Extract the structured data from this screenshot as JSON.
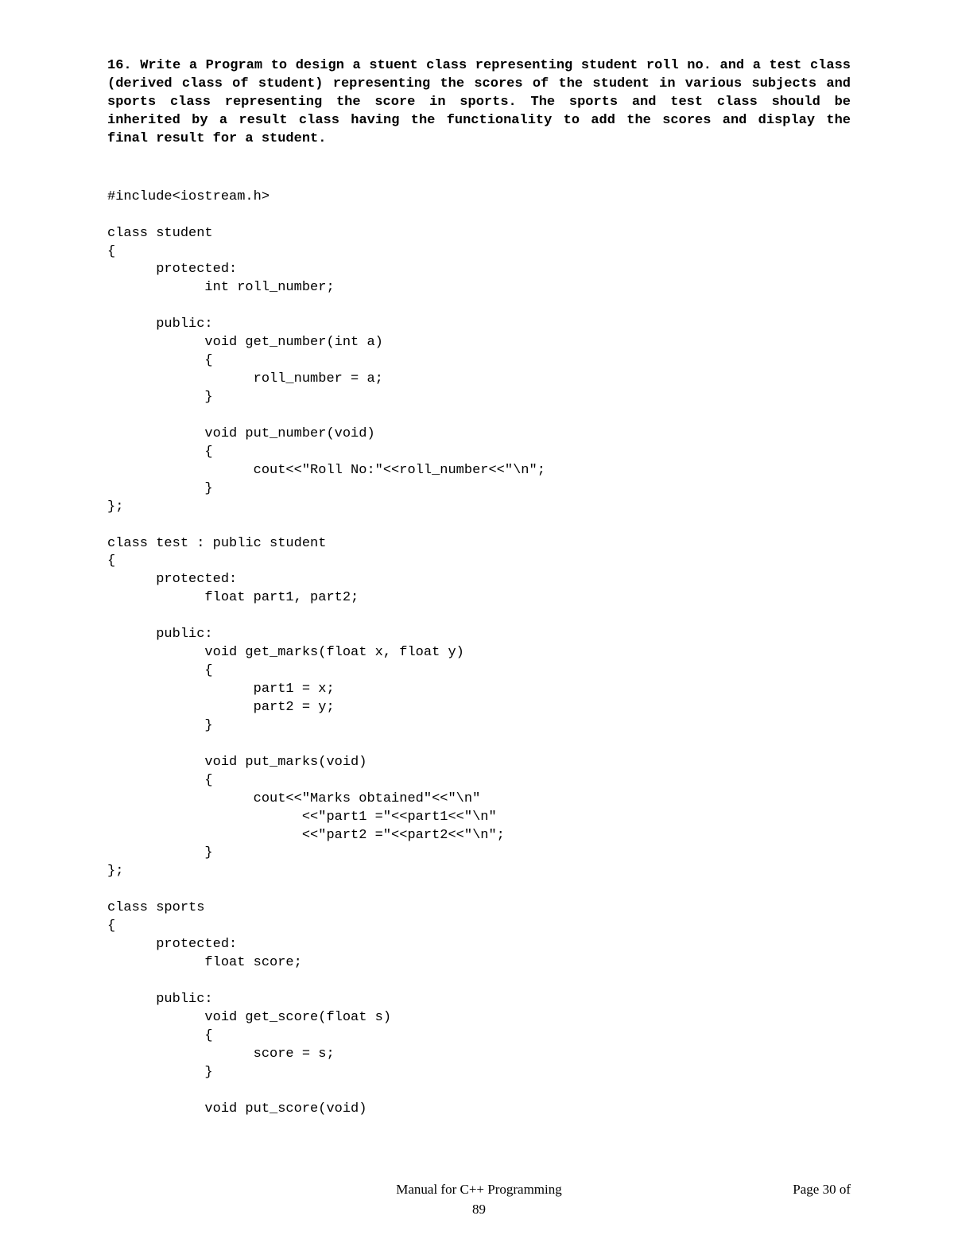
{
  "question": "16. Write a Program to design a stuent class representing student roll no. and a test class (derived class of student) representing the scores of the student in various subjects and sports class representing the score in sports. The sports and test class should be inherited by a result class having the functionality to add the scores and display the final result for a student.",
  "code": "#include<iostream.h>\n\nclass student\n{\n      protected:\n            int roll_number;\n\n      public:\n            void get_number(int a)\n            {\n                  roll_number = a;\n            }\n\n            void put_number(void)\n            {\n                  cout<<\"Roll No:\"<<roll_number<<\"\\n\";\n            }\n};\n\nclass test : public student\n{\n      protected:\n            float part1, part2;\n\n      public:\n            void get_marks(float x, float y)\n            {\n                  part1 = x;\n                  part2 = y;\n            }\n\n            void put_marks(void)\n            {\n                  cout<<\"Marks obtained\"<<\"\\n\"\n                        <<\"part1 =\"<<part1<<\"\\n\"\n                        <<\"part2 =\"<<part2<<\"\\n\";\n            }\n};\n\nclass sports\n{\n      protected:\n            float score;\n\n      public:\n            void get_score(float s)\n            {\n                  score = s;\n            }\n\n            void put_score(void)",
  "footer": {
    "title": "Manual for C++ Programming",
    "page": "Page 30 of",
    "number": "89"
  }
}
